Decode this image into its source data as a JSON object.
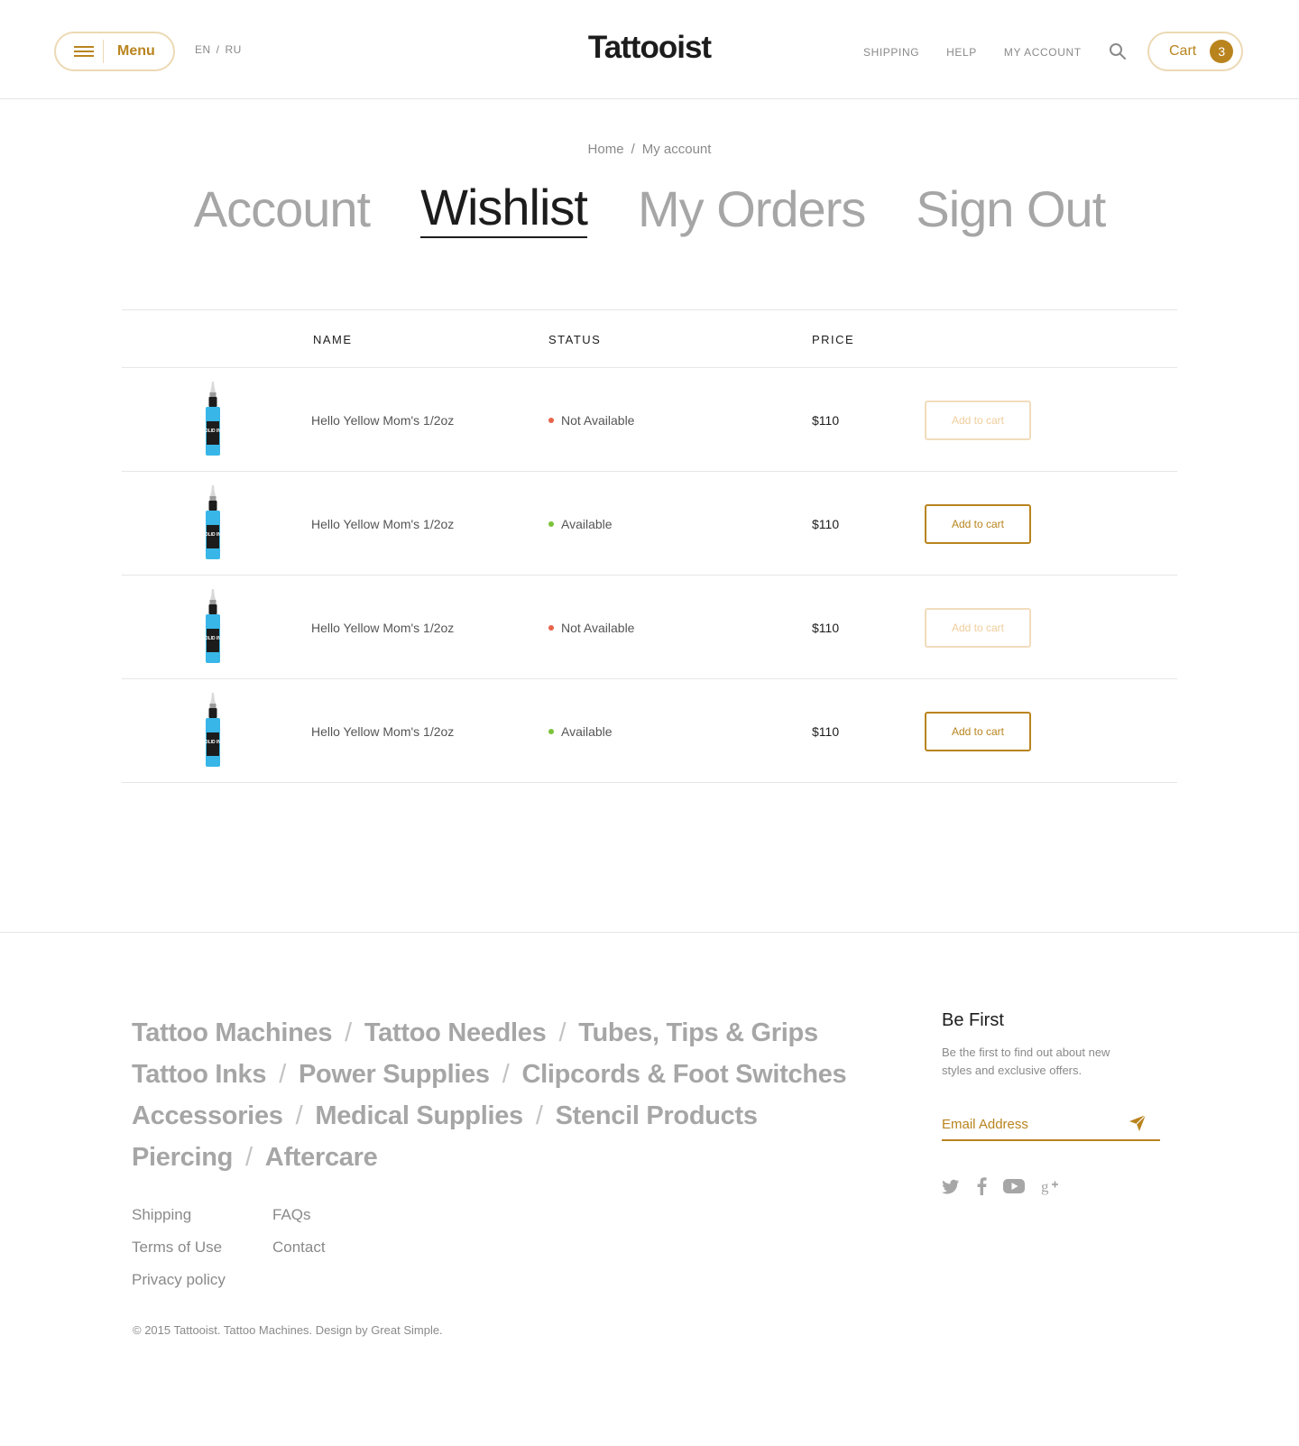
{
  "header": {
    "menu_label": "Menu",
    "lang_en": "EN",
    "lang_ru": "RU",
    "logo": "Tattooist",
    "nav": [
      "SHIPPING",
      "HELP",
      "MY ACCOUNT"
    ],
    "cart_label": "Cart",
    "cart_count": "3",
    "accent_color": "#b9841e"
  },
  "breadcrumb": {
    "home": "Home",
    "current": "My account"
  },
  "tabs": [
    "Account",
    "Wishlist",
    "My Orders",
    "Sign Out"
  ],
  "active_tab": "Wishlist",
  "wishlist": {
    "columns": [
      "NAME",
      "STATUS",
      "PRICE"
    ],
    "rows": [
      {
        "name": "Hello Yellow Mom's 1/2oz",
        "status": "Not Available",
        "status_color": "#e8634a",
        "price": "$110",
        "button": "Add to cart",
        "button_enabled": false
      },
      {
        "name": "Hello Yellow Mom's 1/2oz",
        "status": "Available",
        "status_color": "#7cc33a",
        "price": "$110",
        "button": "Add to cart",
        "button_enabled": true
      },
      {
        "name": "Hello Yellow Mom's 1/2oz",
        "status": "Not Available",
        "status_color": "#e8634a",
        "price": "$110",
        "button": "Add to cart",
        "button_enabled": false
      },
      {
        "name": "Hello Yellow Mom's 1/2oz",
        "status": "Available",
        "status_color": "#7cc33a",
        "price": "$110",
        "button": "Add to cart",
        "button_enabled": true
      }
    ],
    "product_image_text": "SOLID INK"
  },
  "footer": {
    "categories": [
      [
        "Tattoo Machines",
        "Tattoo Needles",
        "Tubes, Tips & Grips"
      ],
      [
        "Tattoo Inks",
        "Power Supplies",
        "Clipcords & Foot Switches"
      ],
      [
        "Accessories",
        "Medical Supplies",
        "Stencil Products"
      ],
      [
        "Piercing",
        "Aftercare"
      ]
    ],
    "links": {
      "shipping": "Shipping",
      "terms": "Terms of Use",
      "privacy": "Privacy policy",
      "faqs": "FAQs",
      "contact": "Contact"
    },
    "copyright": "© 2015 Tattooist. Tattoo Machines.  Design by Great Simple.",
    "subscribe": {
      "title": "Be First",
      "description": "Be the first to find out about new styles and exclusive offers.",
      "placeholder": "Email Address"
    },
    "socials": [
      "twitter-icon",
      "facebook-icon",
      "youtube-icon",
      "google-plus-icon"
    ]
  }
}
